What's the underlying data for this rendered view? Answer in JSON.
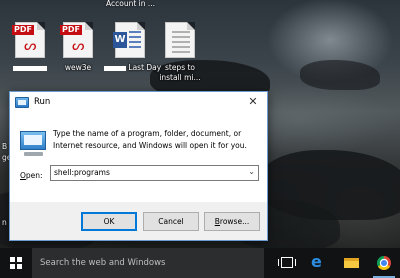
{
  "desktop": {
    "top_label": "Account in ...",
    "icons": [
      {
        "label": "",
        "type": "pdf"
      },
      {
        "label": "wew3e",
        "type": "pdf"
      },
      {
        "label": "Last Day",
        "type": "word"
      },
      {
        "label": "steps to install mi...",
        "type": "text"
      }
    ],
    "side_fragments": [
      "B",
      "ge",
      "n"
    ]
  },
  "run_dialog": {
    "title": "Run",
    "close_glyph": "✕",
    "description": "Type the name of a program, folder, document, or Internet resource, and Windows will open it for you.",
    "open_label_prefix": "O",
    "open_label_rest": "pen:",
    "input_value": "shell:programs",
    "dropdown_glyph": "⌄",
    "ok_label": "OK",
    "cancel_label": "Cancel",
    "browse_label_prefix": "B",
    "browse_label_rest": "rowse..."
  },
  "taskbar": {
    "search_placeholder": "Search the web and Windows",
    "edge_glyph": "e"
  }
}
